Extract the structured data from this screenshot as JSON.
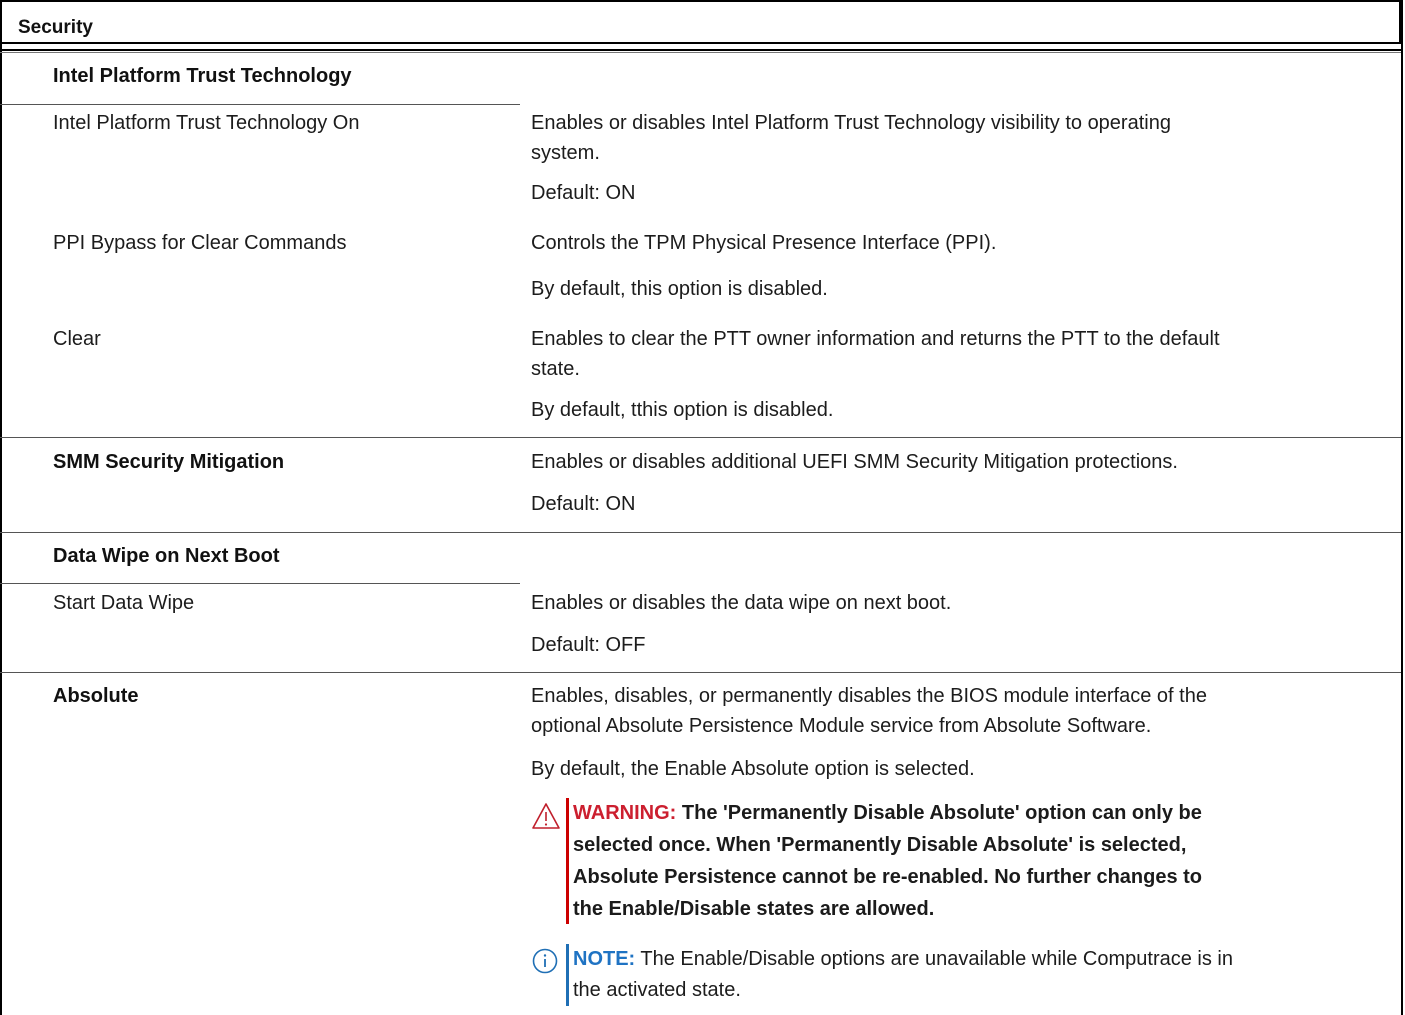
{
  "header": {
    "title": "Security"
  },
  "rows": {
    "ptt_heading": "Intel Platform Trust Technology",
    "ptt_on_label": "Intel Platform Trust Technology On",
    "ptt_on_desc_1": "Enables or disables Intel Platform Trust Technology visibility to operating",
    "ptt_on_desc_2": "system.",
    "ptt_on_default": "Default: ON",
    "ppi_label": "PPI Bypass for Clear Commands",
    "ppi_desc": "Controls the TPM Physical Presence Interface (PPI).",
    "ppi_default": "By default, this option is disabled.",
    "clear_label": "Clear",
    "clear_desc_1": "Enables to clear the PTT owner information and returns the PTT to the default",
    "clear_desc_2": "state.",
    "clear_default": "By default, tthis option is disabled.",
    "smm_label": "SMM Security Mitigation",
    "smm_desc": "Enables or disables additional UEFI SMM Security Mitigation protections.",
    "smm_default": "Default: ON",
    "wipe_heading": "Data Wipe on Next Boot",
    "wipe_label": "Start Data Wipe",
    "wipe_desc": "Enables or disables the data wipe on next boot.",
    "wipe_default": "Default: OFF",
    "absolute_label": "Absolute",
    "absolute_desc_1": "Enables, disables, or permanently disables the BIOS module interface of the",
    "absolute_desc_2": "optional Absolute Persistence Module service from Absolute Software.",
    "absolute_default": "By default, the Enable Absolute option is selected."
  },
  "warning": {
    "label": "WARNING:",
    "line1": " The 'Permanently Disable Absolute' option can only be",
    "line2": "selected once. When 'Permanently Disable Absolute' is selected,",
    "line3": "Absolute Persistence cannot be re-enabled. No further changes to",
    "line4": "the Enable/Disable states are allowed."
  },
  "note": {
    "label": "NOTE:",
    "line1": " The Enable/Disable options are unavailable while Computrace is in",
    "line2": "the activated state."
  },
  "colors": {
    "warning": "#cc1f2f",
    "note": "#1f73c3"
  },
  "icons": {
    "warning": "warning-triangle-icon",
    "note": "info-circle-icon"
  }
}
